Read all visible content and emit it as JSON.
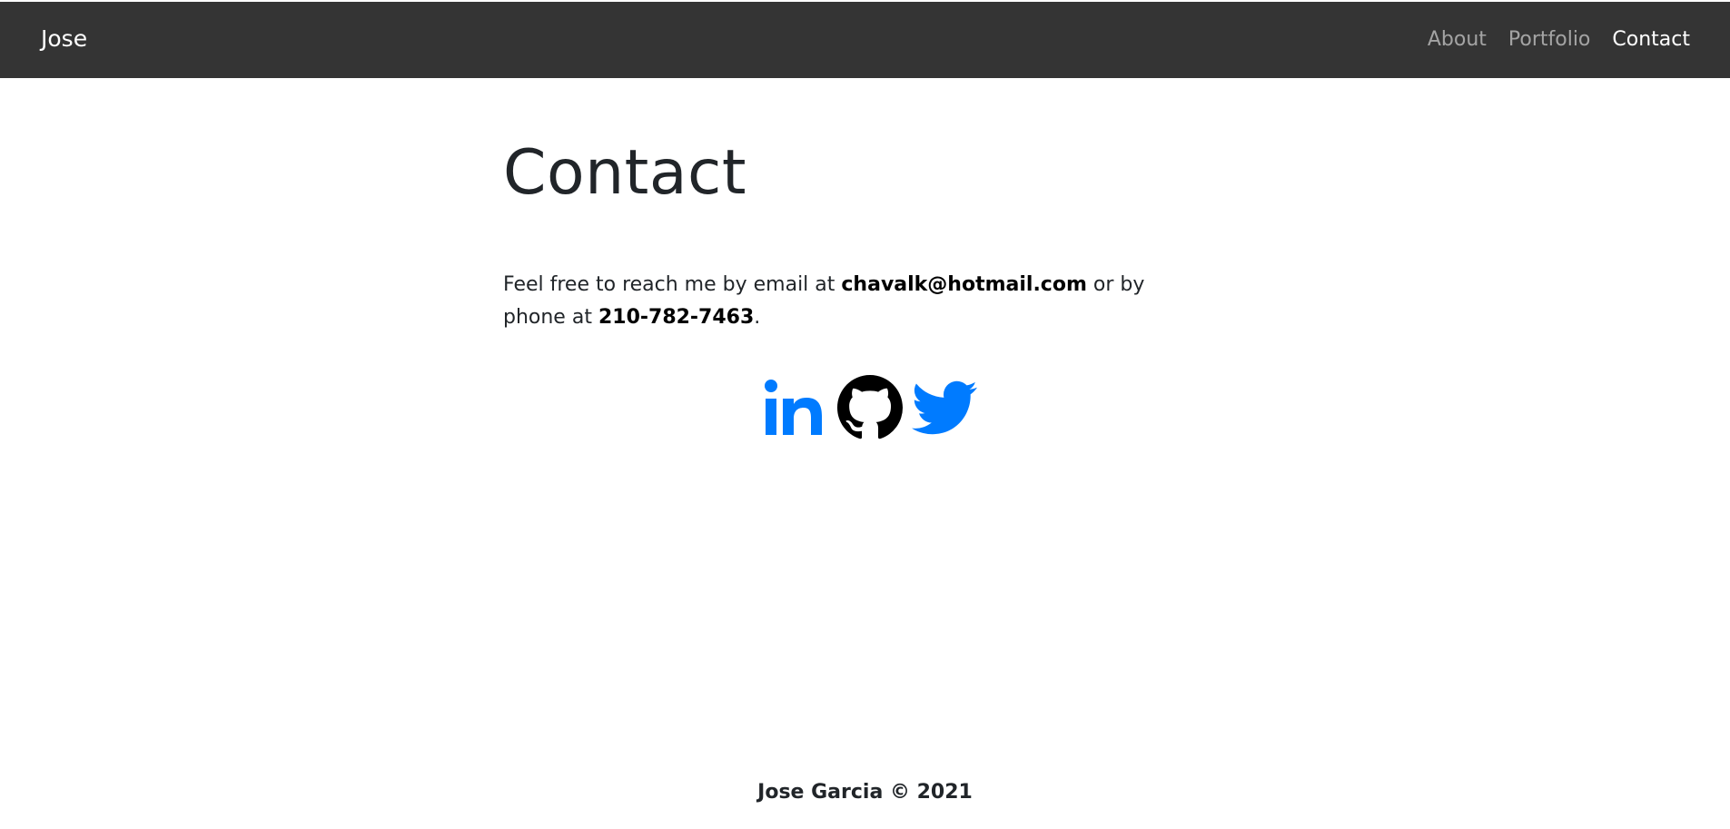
{
  "navbar": {
    "brand": "Jose",
    "links": [
      {
        "label": "About",
        "active": false
      },
      {
        "label": "Portfolio",
        "active": false
      },
      {
        "label": "Contact",
        "active": true
      }
    ],
    "background": "#343434"
  },
  "main": {
    "title": "Contact",
    "text_before_email": "Feel free to reach me by email at ",
    "email": "chavalk@hotmail.com",
    "text_before_phone": " or by phone at ",
    "phone": "210-782-7463",
    "text_after_phone": "."
  },
  "social": {
    "icons": [
      "linkedin-icon",
      "github-icon",
      "twitter-icon"
    ],
    "accent_color": "#007bff",
    "github_color": "#000000"
  },
  "footer": {
    "text": "Jose Garcia © 2021"
  }
}
